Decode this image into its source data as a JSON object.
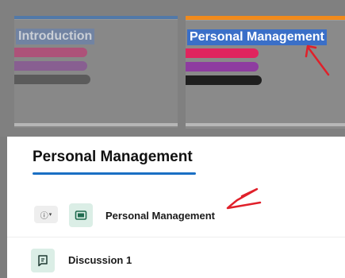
{
  "cards": [
    {
      "title": "Introduction",
      "accent": "#4a78b0"
    },
    {
      "title": "Personal Management",
      "accent": "#f08a1c"
    }
  ],
  "card_bar_colors": [
    "#e0245e",
    "#8e3ca0",
    "#1f1f1f"
  ],
  "panel": {
    "title": "Personal Management",
    "underline_color": "#1a6fc4"
  },
  "items": [
    {
      "label": "Personal Management",
      "icon": "module-icon",
      "type": "module"
    },
    {
      "label": "Discussion 1",
      "icon": "discussion-icon",
      "type": "discussion"
    }
  ],
  "info_button": {
    "icon": "info-icon",
    "caret": "chevron-down-icon"
  },
  "annotation_color": "#e0202a"
}
